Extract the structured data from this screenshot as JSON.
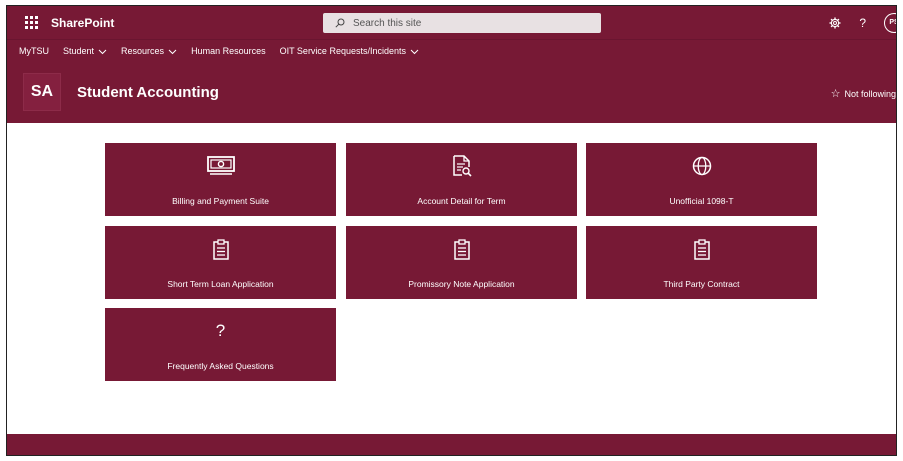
{
  "suitebar": {
    "brand": "SharePoint",
    "search_placeholder": "Search this site",
    "avatar_initials": "PS"
  },
  "hubnav": {
    "items": [
      {
        "label": "MyTSU",
        "has_menu": false
      },
      {
        "label": "Student",
        "has_menu": true
      },
      {
        "label": "Resources",
        "has_menu": true
      },
      {
        "label": "Human Resources",
        "has_menu": false
      },
      {
        "label": "OIT Service Requests/Incidents",
        "has_menu": true
      }
    ]
  },
  "site": {
    "logo_text": "SA",
    "title": "Student Accounting",
    "follow_label": "Not following"
  },
  "tiles": [
    {
      "label": "Billing and Payment Suite",
      "icon": "money-icon"
    },
    {
      "label": "Account Detail for Term",
      "icon": "document-search-icon"
    },
    {
      "label": "Unofficial 1098-T",
      "icon": "globe-icon"
    },
    {
      "label": "Short Term Loan Application",
      "icon": "clipboard-icon"
    },
    {
      "label": "Promissory Note Application",
      "icon": "clipboard-icon"
    },
    {
      "label": "Third Party Contract",
      "icon": "clipboard-icon"
    },
    {
      "label": "Frequently Asked Questions",
      "icon": "question-icon",
      "glyph": "?"
    }
  ],
  "colors": {
    "brand": "#771935",
    "page_background": "#ffffff",
    "text_on_brand": "#ffffff"
  }
}
